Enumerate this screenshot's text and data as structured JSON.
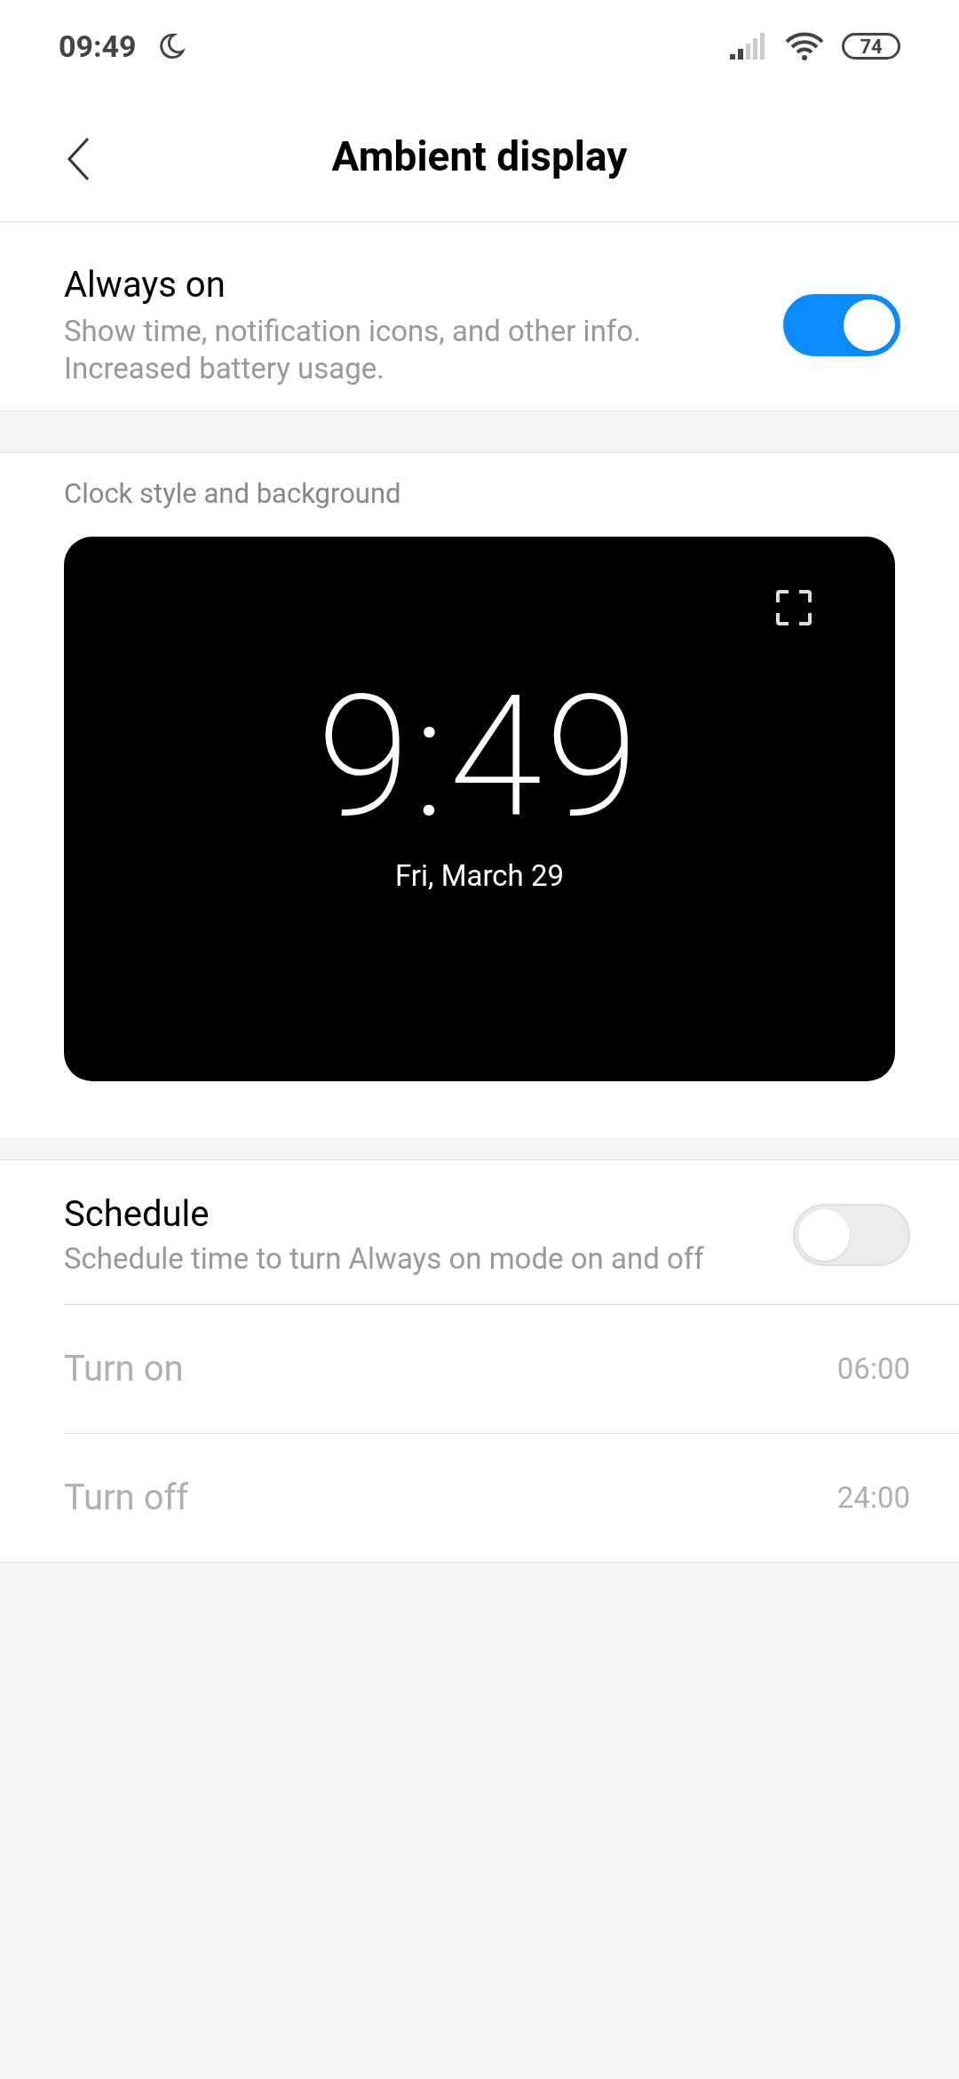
{
  "status_bar": {
    "time": "09:49",
    "battery": "74"
  },
  "header": {
    "title": "Ambient display"
  },
  "always_on": {
    "title": "Always on",
    "description": "Show time, notification icons, and other info. Increased battery usage.",
    "on": true
  },
  "clock_section": {
    "label": "Clock style and background",
    "preview": {
      "time": "9:49",
      "date": "Fri, March 29"
    }
  },
  "schedule": {
    "title": "Schedule",
    "description": "Schedule time to turn Always on mode on and off",
    "on": false,
    "rows": [
      {
        "label": "Turn on",
        "value": "06:00",
        "disabled": true
      },
      {
        "label": "Turn off",
        "value": "24:00",
        "disabled": true
      }
    ]
  }
}
